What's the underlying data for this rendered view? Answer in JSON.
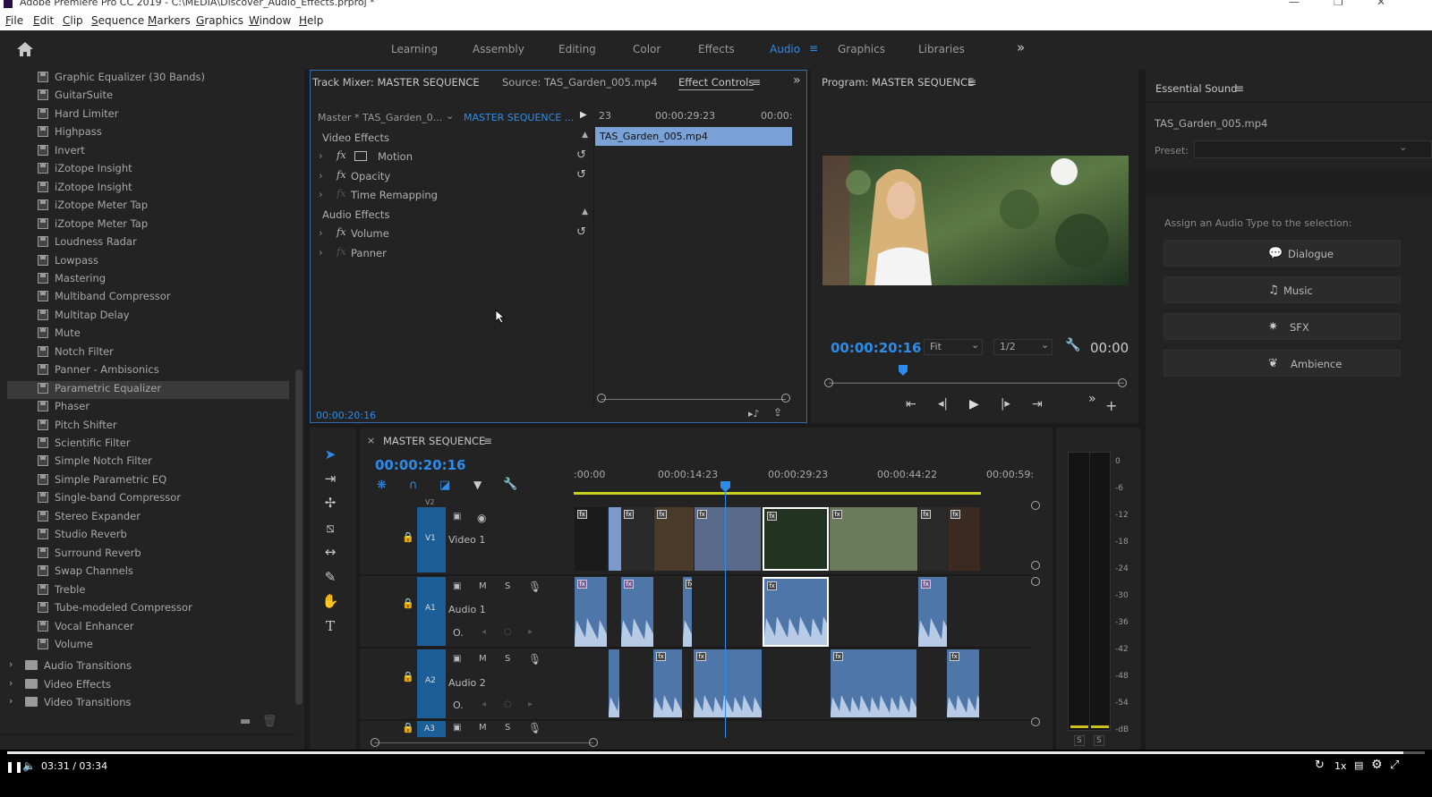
{
  "window": {
    "title": "Adobe Premiere Pro CC 2019 - C:\\MEDIA\\Discover_Audio_Effects.prproj *",
    "minimize": "—",
    "maximize": "❐",
    "close": "✕"
  },
  "menu": [
    "File",
    "Edit",
    "Clip",
    "Sequence",
    "Markers",
    "Graphics",
    "Window",
    "Help"
  ],
  "workspaces": {
    "items": [
      "Learning",
      "Assembly",
      "Editing",
      "Color",
      "Effects",
      "Audio",
      "Graphics",
      "Libraries"
    ],
    "active": "Audio",
    "overflow": "»"
  },
  "effects_panel": {
    "items": [
      "Graphic Equalizer (30 Bands)",
      "GuitarSuite",
      "Hard Limiter",
      "Highpass",
      "Invert",
      "iZotope Insight",
      "iZotope Insight",
      "iZotope Meter Tap",
      "iZotope Meter Tap",
      "Loudness Radar",
      "Lowpass",
      "Mastering",
      "Multiband Compressor",
      "Multitap Delay",
      "Mute",
      "Notch Filter",
      "Panner - Ambisonics",
      "Parametric Equalizer",
      "Phaser",
      "Pitch Shifter",
      "Scientific Filter",
      "Simple Notch Filter",
      "Simple Parametric EQ",
      "Single-band Compressor",
      "Stereo Expander",
      "Studio Reverb",
      "Surround Reverb",
      "Swap Channels",
      "Treble",
      "Tube-modeled Compressor",
      "Vocal Enhancer",
      "Volume"
    ],
    "selected_index": 17,
    "folders": [
      "Audio Transitions",
      "Video Effects",
      "Video Transitions"
    ]
  },
  "source_panel": {
    "tabs": [
      "Track Mixer: MASTER SEQUENCE",
      "Source: TAS_Garden_005.mp4",
      "Effect Controls"
    ],
    "active_tab": "Effect Controls",
    "master_clip": "Master * TAS_Garden_0...",
    "sequence": "MASTER SEQUENCE ...",
    "ruler": [
      "23",
      "00:00:29:23",
      "00:00:"
    ],
    "clip_name": "TAS_Garden_005.mp4",
    "video_section": "Video Effects",
    "video_effects": [
      "Motion",
      "Opacity",
      "Time Remapping"
    ],
    "audio_section": "Audio Effects",
    "audio_effects": [
      "Volume",
      "Panner"
    ],
    "timecode": "00:00:20:16",
    "fx_label": "fx",
    "chevron": "›",
    "reset": "↺"
  },
  "program_panel": {
    "title": "Program: MASTER SEQUENCE",
    "timecode": "00:00:20:16",
    "fit": "Fit",
    "resolution": "1/2",
    "duration": "00:00",
    "progress": 0.25
  },
  "essential_sound": {
    "title": "Essential Sound",
    "clip": "TAS_Garden_005.mp4",
    "preset_label": "Preset:",
    "assign_label": "Assign an Audio Type to the selection:",
    "types": [
      {
        "label": "Dialogue",
        "icon": "💬"
      },
      {
        "label": "Music",
        "icon": "♫"
      },
      {
        "label": "SFX",
        "icon": "✷"
      },
      {
        "label": "Ambience",
        "icon": "❦"
      }
    ]
  },
  "timeline": {
    "close": "×",
    "title": "MASTER SEQUENCE",
    "timecode": "00:00:20:16",
    "ruler": [
      ":00:00",
      "00:00:14:23",
      "00:00:29:23",
      "00:00:44:22",
      "00:00:59:"
    ],
    "tracks": [
      {
        "id": "V2",
        "name": ""
      },
      {
        "id": "V1",
        "name": "Video 1"
      },
      {
        "id": "A1",
        "name": "Audio 1"
      },
      {
        "id": "A2",
        "name": "Audio 2"
      },
      {
        "id": "A3",
        "name": ""
      }
    ],
    "track_buttons": {
      "mute": "M",
      "solo": "S"
    },
    "meter_ticks": [
      "0",
      "-6",
      "-12",
      "-18",
      "-24",
      "-30",
      "-36",
      "-42",
      "-48",
      "-54",
      "-dB"
    ],
    "meter_solo": [
      "S",
      "S"
    ]
  },
  "player": {
    "time": "03:31 / 03:34",
    "speed": "1x",
    "progress": 0.985
  }
}
